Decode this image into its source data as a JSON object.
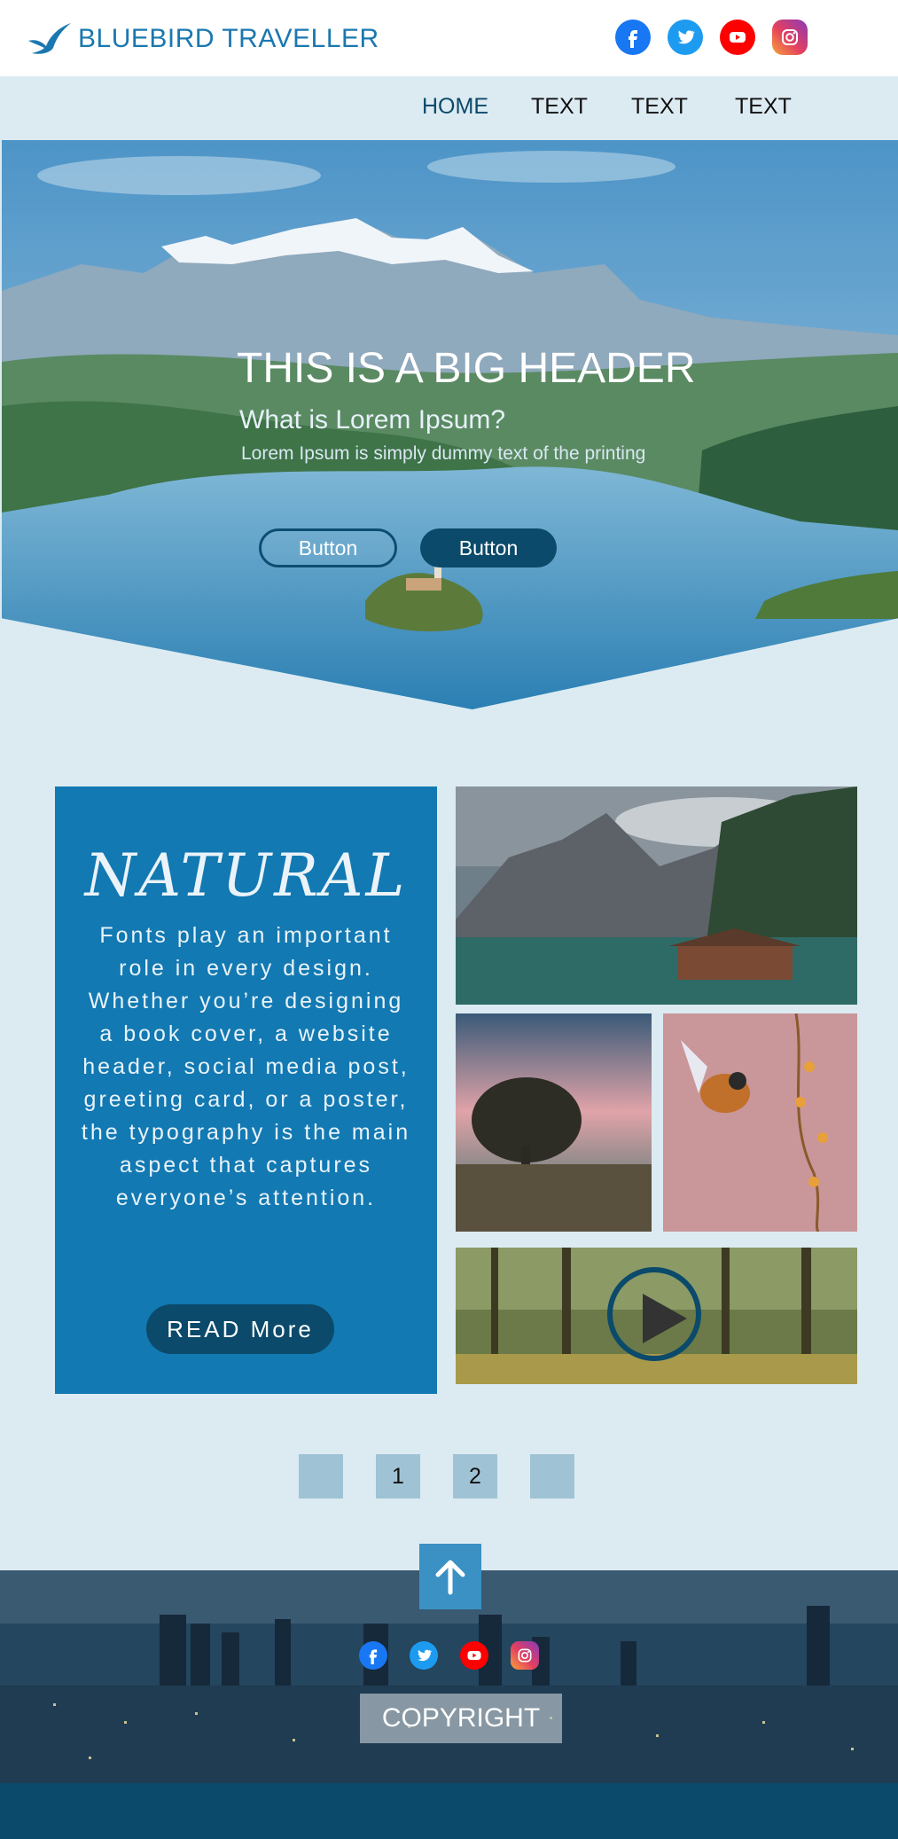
{
  "header": {
    "brand": "BLUEBIRD TRAVELLER",
    "social": [
      {
        "icon": "facebook-icon",
        "color": "#1877f2"
      },
      {
        "icon": "twitter-icon",
        "color": "#1d9bf0"
      },
      {
        "icon": "youtube-icon",
        "color": "#ff0000"
      },
      {
        "icon": "instagram-icon",
        "color": "#e4405f"
      }
    ]
  },
  "nav": {
    "items": [
      {
        "label": "HOME",
        "active": true
      },
      {
        "label": "TEXT"
      },
      {
        "label": "TEXT"
      },
      {
        "label": "TEXT"
      }
    ]
  },
  "hero": {
    "title": "THIS IS A BIG HEADER",
    "subtitle": "What is Lorem Ipsum?",
    "text": "Lorem Ipsum is simply dummy text of the printing",
    "button_outline": "Button",
    "button_fill": "Button"
  },
  "feature": {
    "title": "NATURAL",
    "body": "Fonts play an important role in every design. Whether you’re designing a book cover, a website header, social media post, greeting card, or a poster, the typography is the main aspect that captures everyone’s attention.",
    "cta": "READ More"
  },
  "pagination": {
    "pages": [
      "",
      "1",
      "2",
      ""
    ]
  },
  "footer": {
    "copyright": "COPYRIGHT"
  },
  "colors": {
    "brand": "#1a78b0",
    "dark": "#0b4a6a",
    "card": "#1279b2",
    "page_bg": "#dcebf2"
  }
}
